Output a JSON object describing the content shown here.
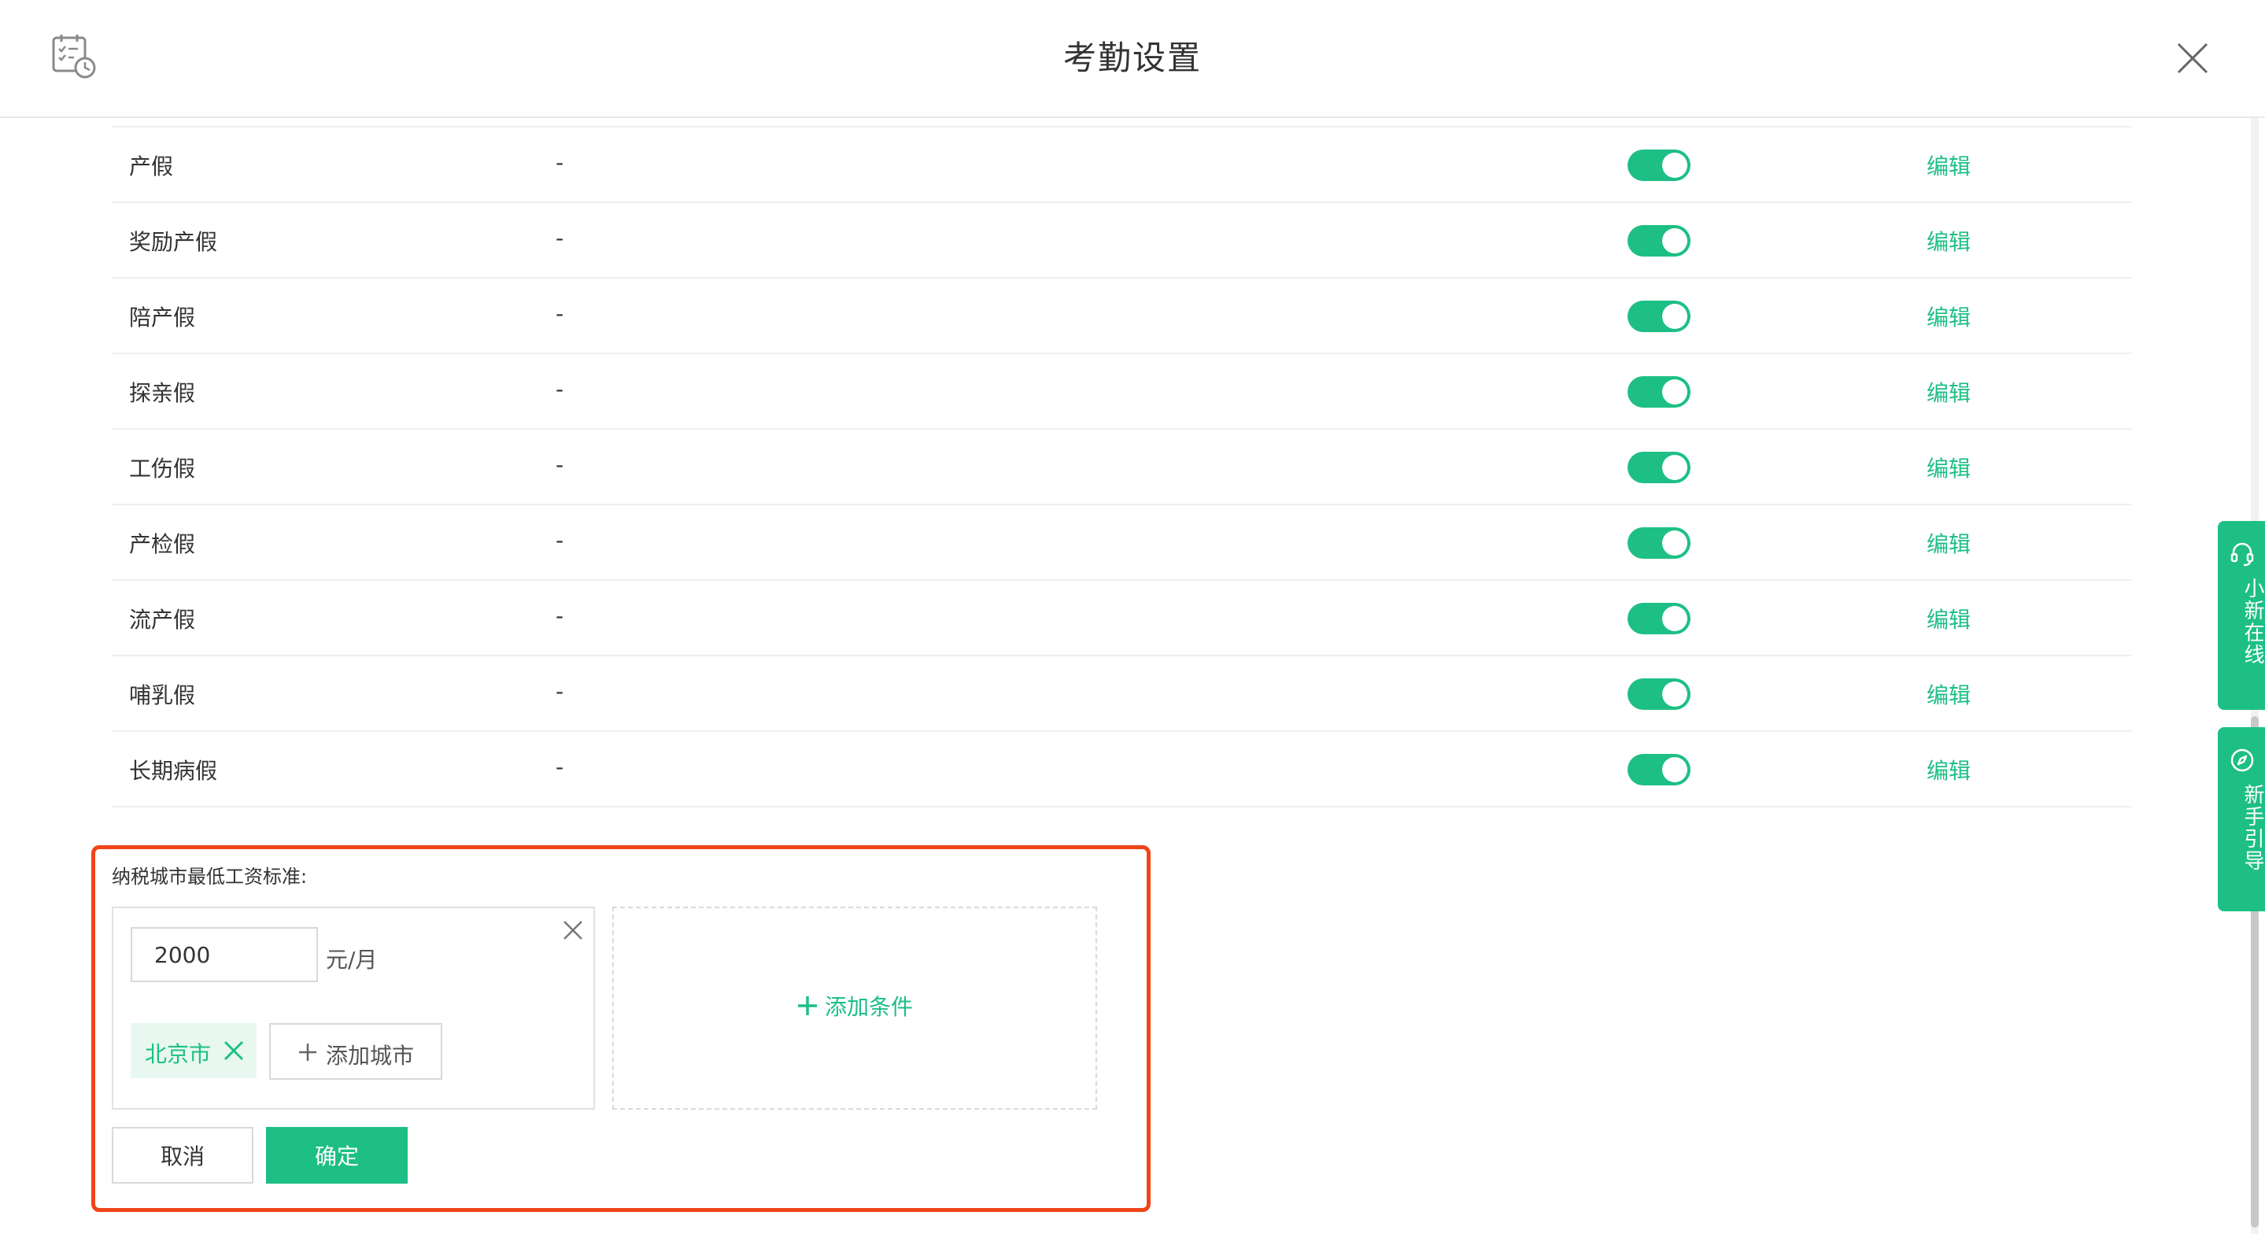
{
  "header": {
    "title": "考勤设置"
  },
  "leave_rows": [
    {
      "name": "产假",
      "desc": "-",
      "enabled": true,
      "action": "编辑"
    },
    {
      "name": "奖励产假",
      "desc": "-",
      "enabled": true,
      "action": "编辑"
    },
    {
      "name": "陪产假",
      "desc": "-",
      "enabled": true,
      "action": "编辑"
    },
    {
      "name": "探亲假",
      "desc": "-",
      "enabled": true,
      "action": "编辑"
    },
    {
      "name": "工伤假",
      "desc": "-",
      "enabled": true,
      "action": "编辑"
    },
    {
      "name": "产检假",
      "desc": "-",
      "enabled": true,
      "action": "编辑"
    },
    {
      "name": "流产假",
      "desc": "-",
      "enabled": true,
      "action": "编辑"
    },
    {
      "name": "哺乳假",
      "desc": "-",
      "enabled": true,
      "action": "编辑"
    },
    {
      "name": "长期病假",
      "desc": "-",
      "enabled": true,
      "action": "编辑"
    }
  ],
  "wage_section": {
    "label": "纳税城市最低工资标准:",
    "condition": {
      "amount": "2000",
      "unit": "元/月",
      "cities": [
        "北京市"
      ],
      "add_city_label": "添加城市"
    },
    "add_condition_label": "添加条件",
    "cancel_label": "取消",
    "confirm_label": "确定"
  },
  "side_tabs": {
    "online": "小新在线",
    "guide": "新手引导"
  },
  "colors": {
    "accent": "#1dbf85",
    "highlight_border": "#f0441a"
  },
  "icons": {
    "header": "calendar-clock-icon",
    "close": "close-icon",
    "online": "headset-icon",
    "guide": "compass-icon"
  }
}
